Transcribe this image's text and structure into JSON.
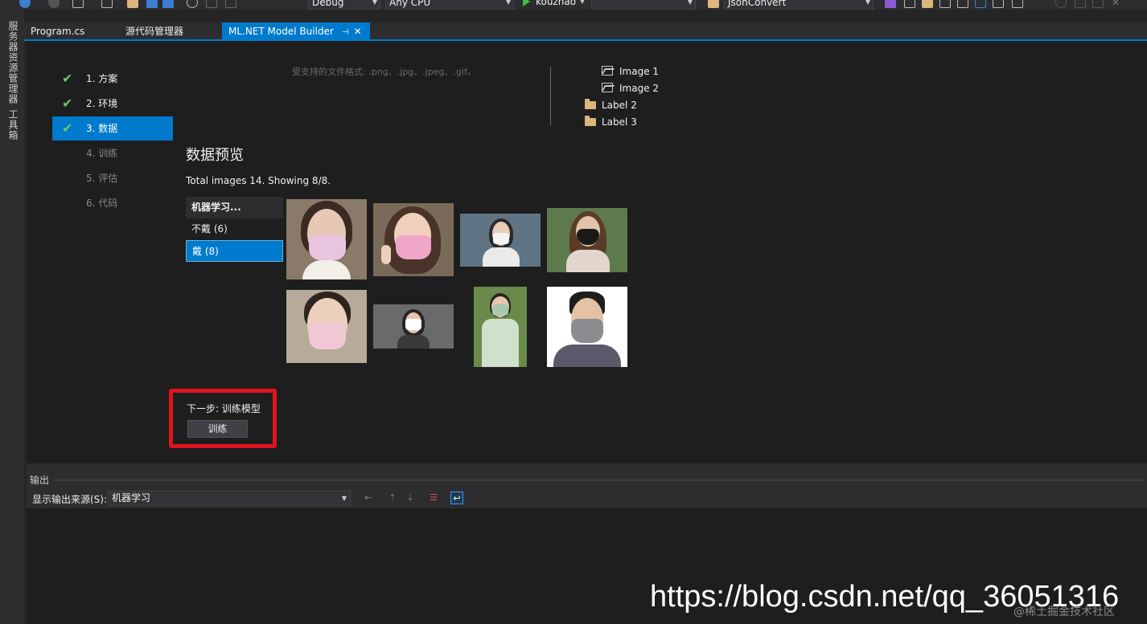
{
  "toolbar": {
    "config": "Debug",
    "platform": "Any CPU",
    "run_target": "kouzhao",
    "startup_combo": "",
    "search_combo": "JsonConvert"
  },
  "left_strip": {
    "tab1": "服务器资源管理器",
    "tab2": "工具箱"
  },
  "doc_tabs": [
    {
      "label": "Program.cs"
    },
    {
      "label": "源代码管理器"
    },
    {
      "label": "ML.NET Model Builder"
    }
  ],
  "steps": [
    {
      "label": "1. 方案",
      "state": "done"
    },
    {
      "label": "2. 环境",
      "state": "done"
    },
    {
      "label": "3. 数据",
      "state": "current"
    },
    {
      "label": "4. 训练",
      "state": "pending"
    },
    {
      "label": "5. 评估",
      "state": "pending"
    },
    {
      "label": "6. 代码",
      "state": "pending"
    }
  ],
  "supported_formats": "受支持的文件格式: .png、.jpg、.jpeg、.gif。",
  "folder_tree": [
    {
      "label": "Image 1",
      "icon": "image-icon"
    },
    {
      "label": "Image 2",
      "icon": "image-icon"
    },
    {
      "label": "Label 2",
      "icon": "folder-icon"
    },
    {
      "label": "Label 3",
      "icon": "folder-icon"
    }
  ],
  "preview": {
    "title": "数据预览",
    "summary": "Total images 14. Showing 8/8.",
    "categories_header": "机器学习...",
    "categories": [
      {
        "label": "不戴 (6)"
      },
      {
        "label": "戴 (8)",
        "selected": true
      }
    ]
  },
  "next_step": {
    "label": "下一步: 训练模型",
    "button": "训练"
  },
  "output": {
    "title": "输出",
    "source_label": "显示输出来源(S):",
    "source_value": "机器学习"
  },
  "watermark": "https://blog.csdn.net/qq_36051316",
  "watermark_small": "@稀土掘金技术社区",
  "colors": {
    "accent": "#007acc",
    "highlight_box": "#e0141e",
    "check": "#6ec46e"
  }
}
